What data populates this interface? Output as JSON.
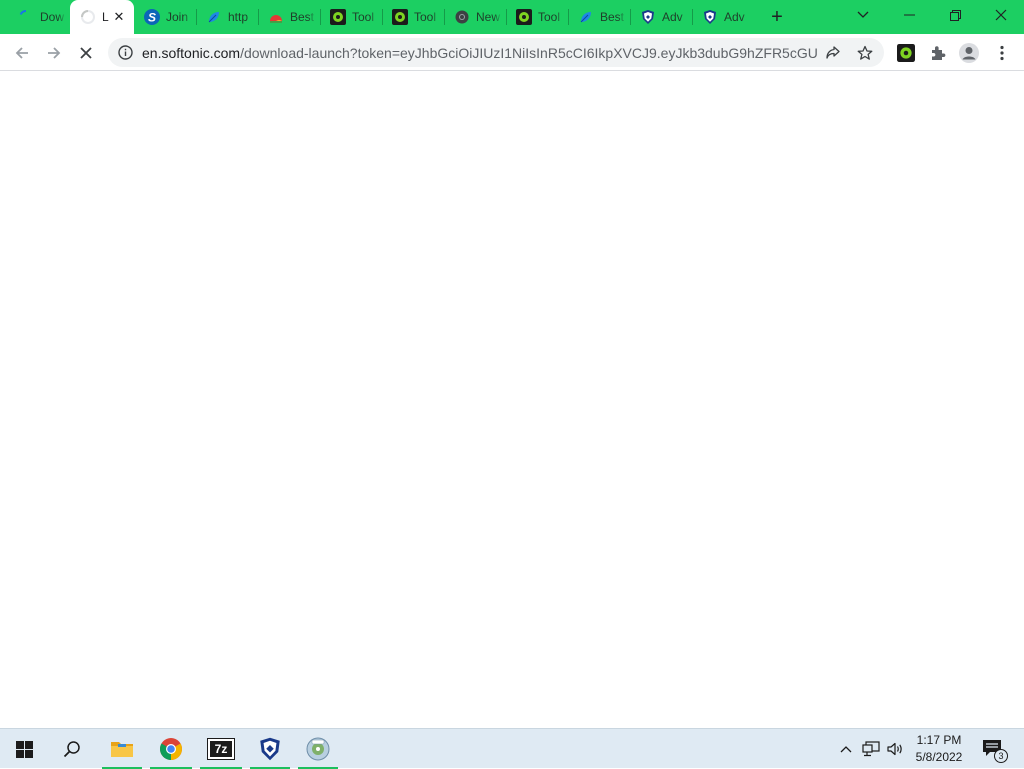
{
  "browser": {
    "tabs": [
      {
        "title": "Dow",
        "favicon": "loading-spinner-icon",
        "active": false
      },
      {
        "title": "L",
        "favicon": "loading-spinner-icon",
        "active": true
      },
      {
        "title": "Join",
        "favicon": "softonic-s-icon",
        "active": false
      },
      {
        "title": "http",
        "favicon": "blue-leaf-icon",
        "active": false
      },
      {
        "title": "Best",
        "favicon": "chart-icon",
        "active": false
      },
      {
        "title": "Tool",
        "favicon": "green-gear-icon",
        "active": false
      },
      {
        "title": "Tool",
        "favicon": "green-gear-icon",
        "active": false
      },
      {
        "title": "New",
        "favicon": "chrome-gray-icon",
        "active": false
      },
      {
        "title": "Tool",
        "favicon": "green-gear-icon",
        "active": false
      },
      {
        "title": "Best",
        "favicon": "blue-leaf-icon",
        "active": false
      },
      {
        "title": "Adv",
        "favicon": "shield-icon",
        "active": false
      },
      {
        "title": "Adv",
        "favicon": "shield-icon",
        "active": false
      }
    ],
    "new_tab_glyph": "+",
    "window_controls": {
      "dropdown": "⌄",
      "minimize": "—",
      "restore": "❐",
      "close": "✕"
    },
    "url_host": "en.softonic.com",
    "url_path": "/download-launch?token=eyJhbGciOiJIUzI1NiIsInR5cCI6IkpXVCJ9.eyJkb3dubG9hZFR5cGUi...",
    "colors": {
      "tabstrip": "#1ccf62",
      "accent": "#1dbf5d"
    }
  },
  "taskbar": {
    "apps": [
      {
        "name": "file-explorer",
        "running": true
      },
      {
        "name": "chrome",
        "running": true
      },
      {
        "name": "7zip",
        "label": "7z",
        "running": true
      },
      {
        "name": "shield-app",
        "running": true
      },
      {
        "name": "disk-app",
        "running": true
      }
    ],
    "clock": {
      "time": "1:17 PM",
      "date": "5/8/2022"
    },
    "notification_count": "3"
  }
}
